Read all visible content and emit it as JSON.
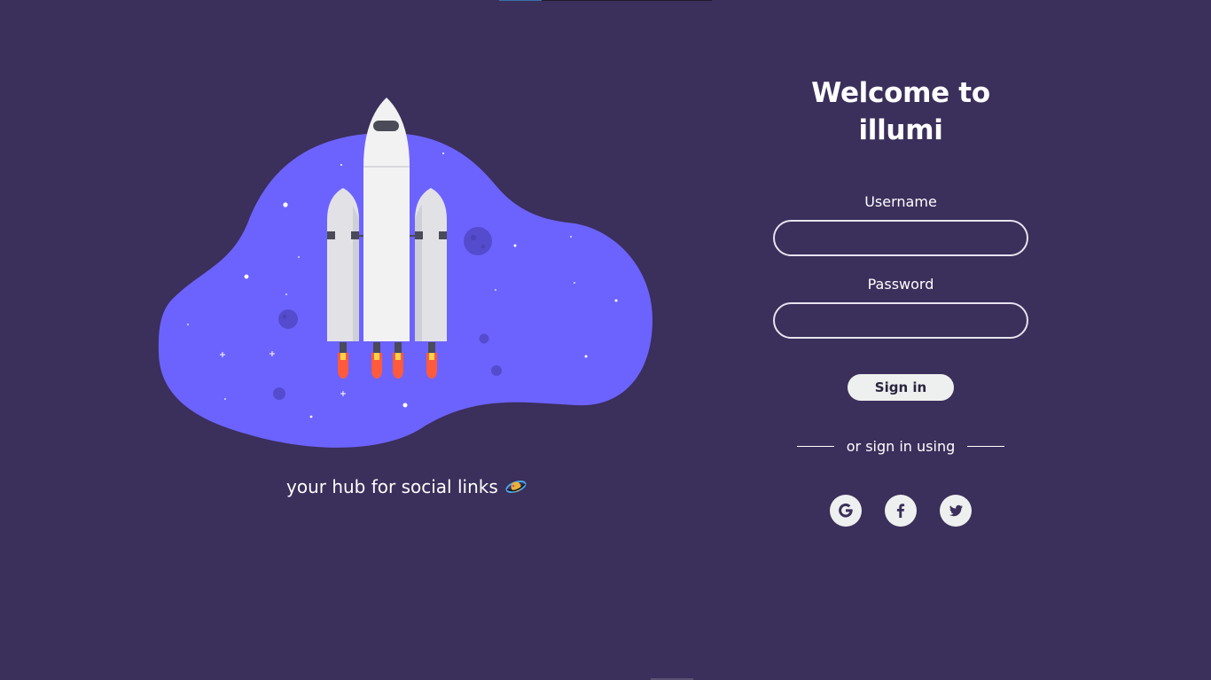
{
  "colors": {
    "background": "#3b2f5b",
    "blob": "#6c63ff",
    "text": "#ffffff",
    "button_bg": "#eef0ef",
    "button_text": "#2a2440",
    "input_border": "#e6e3ee",
    "flame": "#ff5a3c"
  },
  "hero": {
    "illustration": "rocket-launch-illustration",
    "tagline": "your hub for social links"
  },
  "login": {
    "title": "Welcome to illumi",
    "username_label": "Username",
    "username_value": "",
    "password_label": "Password",
    "password_value": "",
    "signin_label": "Sign in",
    "divider_text": "or sign in using"
  },
  "social": [
    {
      "name": "Google",
      "icon": "google-icon"
    },
    {
      "name": "Facebook",
      "icon": "facebook-icon"
    },
    {
      "name": "Twitter",
      "icon": "twitter-icon"
    }
  ]
}
